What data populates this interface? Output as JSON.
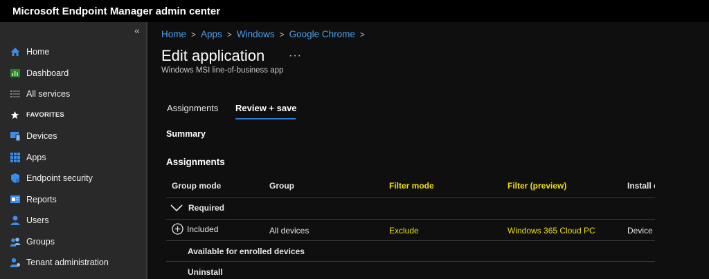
{
  "app_title": "Microsoft Endpoint Manager admin center",
  "sidebar": {
    "collapse_glyph": "«",
    "items": [
      {
        "label": "Home",
        "icon": "home-icon",
        "color": "#3b8ee8"
      },
      {
        "label": "Dashboard",
        "icon": "dashboard-icon",
        "color": "#5ab550"
      },
      {
        "label": "All services",
        "icon": "list-icon",
        "color": "#9a9a9a"
      },
      {
        "label": "FAVORITES",
        "icon": "star-icon",
        "color": "#ffffff"
      },
      {
        "label": "Devices",
        "icon": "devices-icon",
        "color": "#3b8ee8"
      },
      {
        "label": "Apps",
        "icon": "apps-icon",
        "color": "#3b8ee8"
      },
      {
        "label": "Endpoint security",
        "icon": "shield-icon",
        "color": "#3b8ee8"
      },
      {
        "label": "Reports",
        "icon": "reports-icon",
        "color": "#3b8ee8"
      },
      {
        "label": "Users",
        "icon": "user-icon",
        "color": "#3b8ee8"
      },
      {
        "label": "Groups",
        "icon": "groups-icon",
        "color": "#3b8ee8"
      },
      {
        "label": "Tenant administration",
        "icon": "tenant-icon",
        "color": "#3b8ee8"
      }
    ]
  },
  "breadcrumb": [
    "Home",
    "Apps",
    "Windows",
    "Google Chrome"
  ],
  "page": {
    "title": "Edit application",
    "more_glyph": "···",
    "subtitle": "Windows MSI line-of-business app"
  },
  "tabs": [
    {
      "label": "Assignments",
      "active": false
    },
    {
      "label": "Review + save",
      "active": true
    }
  ],
  "summary_label": "Summary",
  "assignments_label": "Assignments",
  "table": {
    "headers": [
      "Group mode",
      "Group",
      "Filter mode",
      "Filter (preview)",
      "Install context"
    ],
    "required_label": "Required",
    "row": {
      "group_mode": "Included",
      "group": "All devices",
      "filter_mode": "Exclude",
      "filter": "Windows 365 Cloud PC",
      "install_context": "Device"
    },
    "available_label": "Available for enrolled devices",
    "uninstall_label": "Uninstall"
  },
  "colors": {
    "accent": "#2f7fe0",
    "link": "#4aa0f0",
    "highlight": "#f0e000"
  }
}
